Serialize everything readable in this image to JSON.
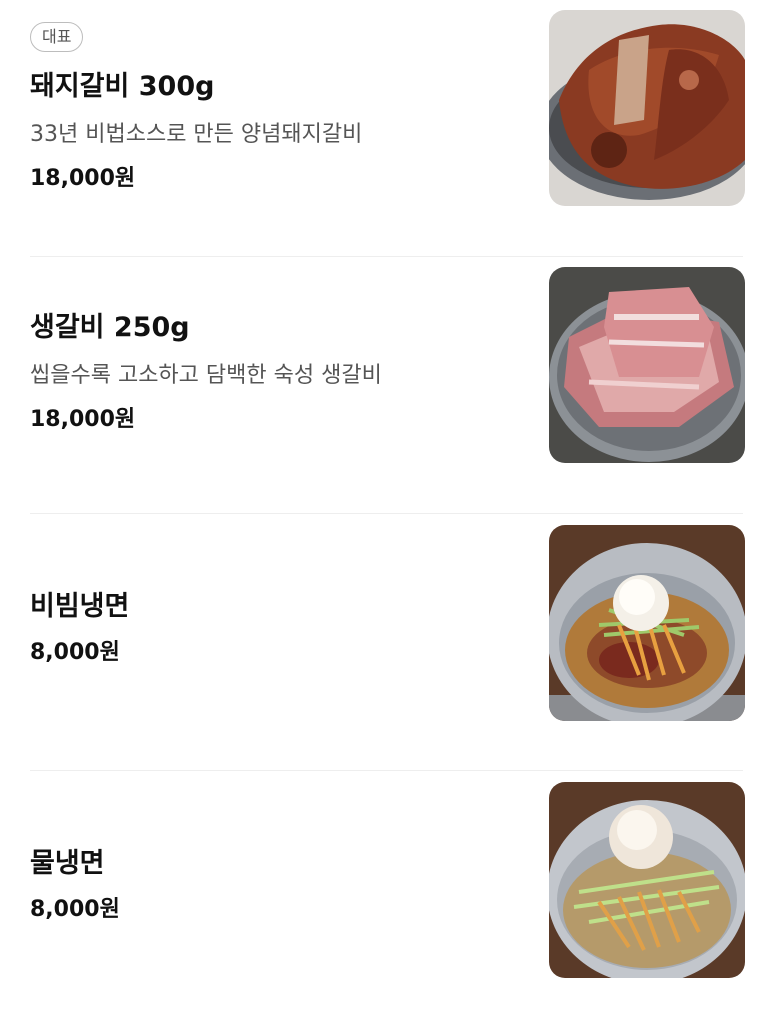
{
  "menu": {
    "items": [
      {
        "badge": "대표",
        "name": "돼지갈비 300g",
        "description": "33년 비법소스로 만든 양념돼지갈비",
        "price": "18,000원",
        "image": "marinated-pork-ribs-photo"
      },
      {
        "name": "생갈비 250g",
        "description": "씹을수록 고소하고 담백한 숙성 생갈비",
        "price": "18,000원",
        "image": "raw-pork-ribs-photo"
      },
      {
        "name": "비빔냉면",
        "price": "8,000원",
        "image": "spicy-cold-noodles-photo"
      },
      {
        "name": "물냉면",
        "price": "8,000원",
        "image": "cold-broth-noodles-photo"
      }
    ]
  }
}
